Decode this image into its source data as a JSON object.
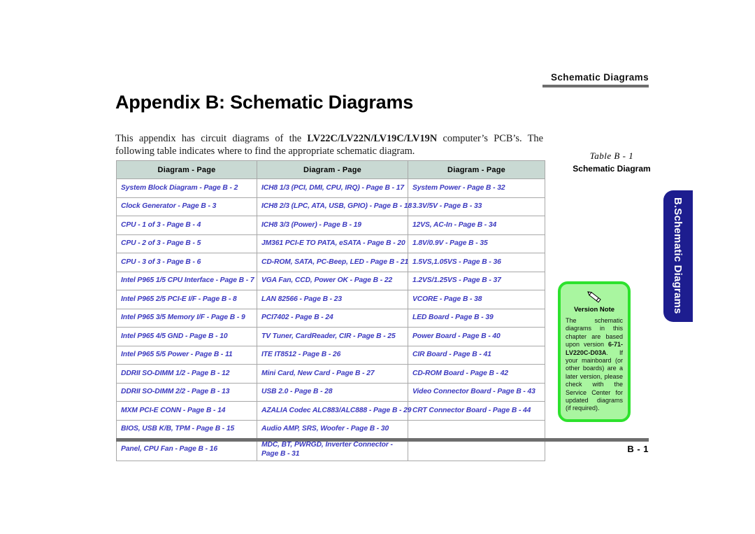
{
  "running_header": {
    "text": "Schematic  Diagrams"
  },
  "page_title": "Appendix B: Schematic Diagrams",
  "intro": {
    "before_bold": "This appendix has circuit diagrams of the ",
    "bold": "LV22C/LV22N/LV19C/LV19N",
    "after_bold": " computer’s PCB’s. The following table indicates where to find the appropriate schematic diagram."
  },
  "table": {
    "headers": [
      "Diagram - Page",
      "Diagram - Page",
      "Diagram - Page"
    ],
    "rows": [
      [
        "System Block Diagram - Page  B - 2",
        "ICH8 1/3 (PCI, DMI, CPU, IRQ) - Page  B - 17",
        "System Power - Page  B - 32"
      ],
      [
        "Clock Generator - Page  B - 3",
        "ICH8 2/3 (LPC, ATA, USB, GPIO) - Page  B - 18",
        "3.3V/5V - Page  B - 33"
      ],
      [
        "CPU - 1 of 3 - Page  B - 4",
        "ICH8 3/3 (Power) - Page  B - 19",
        "12VS, AC-In - Page  B - 34"
      ],
      [
        "CPU - 2 of 3 - Page  B - 5",
        "JM361 PCI-E TO PATA, eSATA - Page  B - 20",
        "1.8V/0.9V - Page  B - 35"
      ],
      [
        "CPU - 3 of 3 - Page  B - 6",
        "CD-ROM, SATA, PC-Beep, LED - Page  B - 21",
        "1.5VS,1.05VS - Page  B - 36"
      ],
      [
        "Intel P965 1/5 CPU Interface - Page  B - 7",
        "VGA Fan, CCD, Power OK - Page  B - 22",
        "1.2VS/1.25VS - Page  B - 37"
      ],
      [
        "Intel P965 2/5 PCI-E I/F - Page  B - 8",
        "LAN 82566 - Page  B - 23",
        "VCORE - Page  B - 38"
      ],
      [
        "Intel P965 3/5 Memory I/F - Page  B - 9",
        "PCI7402 - Page  B - 24",
        "LED Board - Page  B - 39"
      ],
      [
        "Intel P965 4/5 GND - Page  B - 10",
        "TV Tuner, CardReader, CIR - Page  B - 25",
        "Power Board - Page  B - 40"
      ],
      [
        "Intel P965 5/5 Power - Page  B - 11",
        "ITE IT8512 - Page  B - 26",
        "CIR Board - Page  B - 41"
      ],
      [
        "DDRII SO-DIMM 1/2 - Page  B - 12",
        "Mini Card, New Card - Page  B - 27",
        "CD-ROM Board - Page  B - 42"
      ],
      [
        "DDRII SO-DIMM 2/2 - Page  B - 13",
        "USB 2.0 - Page  B - 28",
        "Video Connector Board - Page  B - 43"
      ],
      [
        "MXM PCI-E CONN - Page  B - 14",
        "AZALIA Codec ALC883/ALC888 - Page  B - 29",
        "CRT Connector Board - Page  B - 44"
      ],
      [
        "BIOS, USB K/B, TPM - Page  B - 15",
        "Audio AMP, SRS, Woofer - Page  B - 30",
        ""
      ],
      [
        "Panel, CPU Fan - Page  B - 16",
        "MDC, BT, PWRGD, Inverter Connector - Page  B - 31",
        ""
      ]
    ]
  },
  "caption": {
    "number": "Table B - 1",
    "title": "Schematic Diagram"
  },
  "version_note": {
    "icon": "pencil-icon",
    "title": "Version Note",
    "body_part1": "The schematic diagrams in this chapter are based upon version ",
    "body_bold": "6-71-LV220C-D03A",
    "body_part2": ". If your mainboard (or other boards) are a later version, please check with the Service Center for updated diagrams (if required)."
  },
  "side_tab": {
    "label": "B.Schematic Diagrams"
  },
  "footer": {
    "page_number": "B  -  1"
  },
  "colors": {
    "table_header_bg": "#c9d9d3",
    "table_text": "#3b39bf",
    "note_bg": "#a9f6a0",
    "note_border": "#2de22d",
    "side_tab_bg": "#1d1d8f",
    "rule_gray": "#6e6e6e"
  }
}
